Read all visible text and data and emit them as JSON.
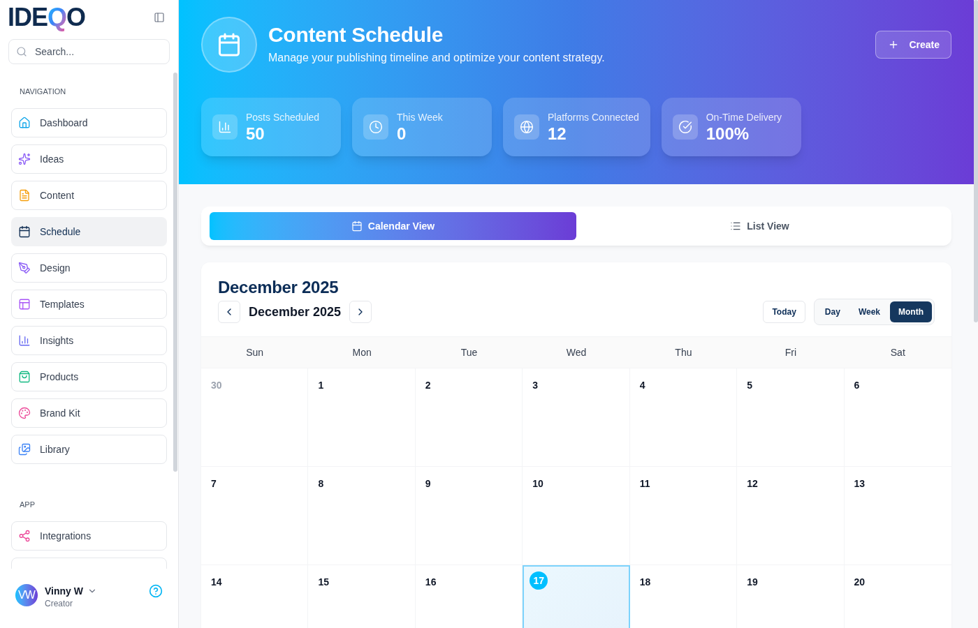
{
  "sidebar": {
    "logo": {
      "parts": [
        {
          "text": "IDE",
          "kind": "plain"
        },
        {
          "text": "Q",
          "kind": "accent"
        },
        {
          "text": "O",
          "kind": "plain"
        }
      ]
    },
    "search": {
      "placeholder": "Search..."
    },
    "sections": [
      {
        "title": "NAVIGATION",
        "items": [
          {
            "label": "Dashboard",
            "kind": "link",
            "selected": false
          },
          {
            "label": "Ideas",
            "kind": "link",
            "selected": false
          },
          {
            "label": "Content",
            "kind": "link",
            "selected": false
          },
          {
            "label": "Schedule",
            "kind": "link",
            "selected": true
          },
          {
            "label": "Design",
            "kind": "link",
            "selected": false
          },
          {
            "label": "Templates",
            "kind": "link",
            "selected": false
          },
          {
            "label": "Insights",
            "kind": "link",
            "selected": false
          },
          {
            "label": "Products",
            "kind": "link",
            "selected": false
          },
          {
            "label": "Brand Kit",
            "kind": "link",
            "selected": false
          },
          {
            "label": "Library",
            "kind": "link",
            "selected": false
          }
        ]
      },
      {
        "title": "APP",
        "items": [
          {
            "label": "Integrations",
            "kind": "link",
            "selected": false
          },
          {
            "kind": "cut_off",
            "selected": false
          }
        ]
      }
    ],
    "user": {
      "initials": "VW",
      "name": "Vinny W",
      "role": "Creator"
    }
  },
  "header": {
    "title": "Content Schedule",
    "subtitle": "Manage your publishing timeline and optimize your content strategy.",
    "create_button": "Create",
    "stats": [
      {
        "label": "Posts Scheduled",
        "value": "50"
      },
      {
        "label": "This Week",
        "value": "0"
      },
      {
        "label": "Platforms Connected",
        "value": "12"
      },
      {
        "label": "On-Time Delivery",
        "value": "100%"
      }
    ]
  },
  "view_tabs": [
    {
      "label": "Calendar View",
      "selected": true
    },
    {
      "label": "List View",
      "selected": false
    }
  ],
  "calendar": {
    "title": "December 2025",
    "period": "December 2025",
    "today_button": "Today",
    "modes": [
      {
        "label": "Day",
        "selected": false
      },
      {
        "label": "Week",
        "selected": false
      },
      {
        "label": "Month",
        "selected": true
      }
    ],
    "weekdays": [
      "Sun",
      "Mon",
      "Tue",
      "Wed",
      "Thu",
      "Fri",
      "Sat"
    ],
    "weeks": [
      [
        {
          "day": "30",
          "outside": true,
          "today": false
        },
        {
          "day": "1",
          "outside": false,
          "today": false
        },
        {
          "day": "2",
          "outside": false,
          "today": false
        },
        {
          "day": "3",
          "outside": false,
          "today": false
        },
        {
          "day": "4",
          "outside": false,
          "today": false
        },
        {
          "day": "5",
          "outside": false,
          "today": false
        },
        {
          "day": "6",
          "outside": false,
          "today": false
        }
      ],
      [
        {
          "day": "7",
          "outside": false,
          "today": false
        },
        {
          "day": "8",
          "outside": false,
          "today": false
        },
        {
          "day": "9",
          "outside": false,
          "today": false
        },
        {
          "day": "10",
          "outside": false,
          "today": false
        },
        {
          "day": "11",
          "outside": false,
          "today": false
        },
        {
          "day": "12",
          "outside": false,
          "today": false
        },
        {
          "day": "13",
          "outside": false,
          "today": false
        }
      ],
      [
        {
          "day": "14",
          "outside": false,
          "today": false
        },
        {
          "day": "15",
          "outside": false,
          "today": false
        },
        {
          "day": "16",
          "outside": false,
          "today": false
        },
        {
          "day": "17",
          "outside": false,
          "today": true
        },
        {
          "day": "18",
          "outside": false,
          "today": false
        },
        {
          "day": "19",
          "outside": false,
          "today": false
        },
        {
          "day": "20",
          "outside": false,
          "today": false
        }
      ]
    ]
  }
}
